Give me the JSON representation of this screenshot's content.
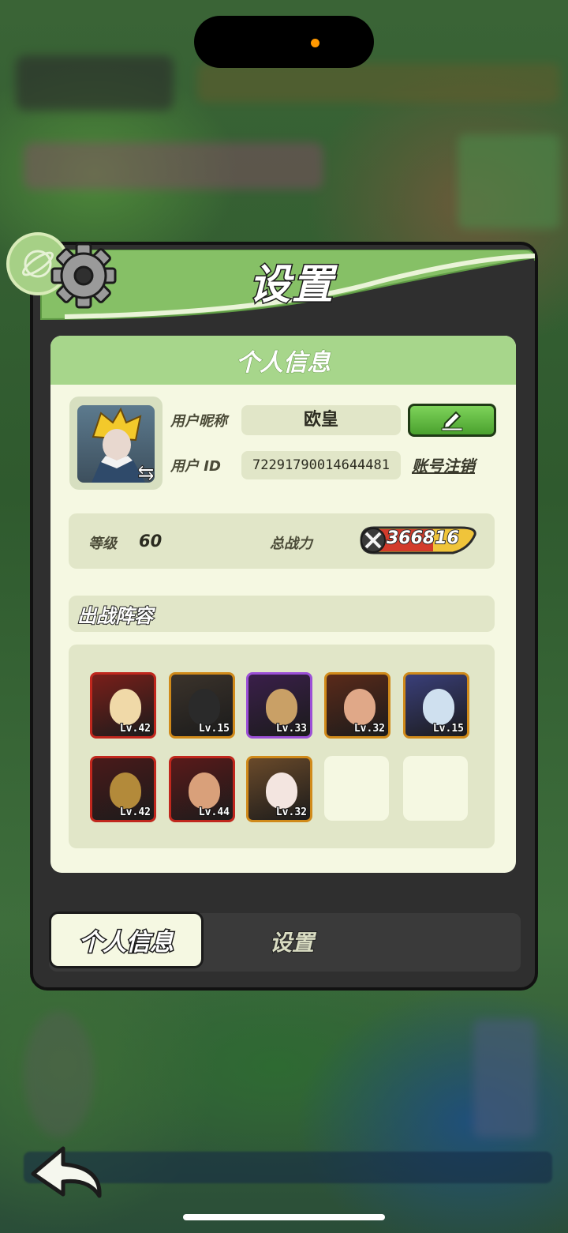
{
  "panel": {
    "title": "设置",
    "section_title": "个人信息"
  },
  "profile": {
    "nickname_label": "用户昵称",
    "nickname": "欧皇",
    "id_label": "用户 ID",
    "user_id": "72291790014644481",
    "logout_label": "账号注销"
  },
  "stats": {
    "level_label": "等级",
    "level": "60",
    "power_label": "总战力",
    "power": "366816"
  },
  "lineup": {
    "title": "出战阵容",
    "heroes": [
      {
        "lv": "Lv.42",
        "frame": "#c0271d",
        "bg": "#7a1f1a",
        "face": "#f0d9a8"
      },
      {
        "lv": "Lv.15",
        "frame": "#d08a1a",
        "bg": "#3b332b",
        "face": "#2a2a2a"
      },
      {
        "lv": "Lv.33",
        "frame": "#9b4fd6",
        "bg": "#3a1f4a",
        "face": "#c9a066"
      },
      {
        "lv": "Lv.32",
        "frame": "#d08a1a",
        "bg": "#5a2a1a",
        "face": "#e0a888"
      },
      {
        "lv": "Lv.15",
        "frame": "#d08a1a",
        "bg": "#3a3f7a",
        "face": "#cfe0ef"
      },
      {
        "lv": "Lv.42",
        "frame": "#c0271d",
        "bg": "#4a1a1a",
        "face": "#b38a3a"
      },
      {
        "lv": "Lv.44",
        "frame": "#c0271d",
        "bg": "#5a1a1a",
        "face": "#d9a07a"
      },
      {
        "lv": "Lv.32",
        "frame": "#d08a1a",
        "bg": "#6a4a2a",
        "face": "#f3e5e0"
      }
    ]
  },
  "tabs": {
    "active": "个人信息",
    "inactive": "设置"
  },
  "colors": {
    "header_green": "#79b35a",
    "card_bg": "#f5f8e2",
    "edit_green": "#4aa12e"
  }
}
